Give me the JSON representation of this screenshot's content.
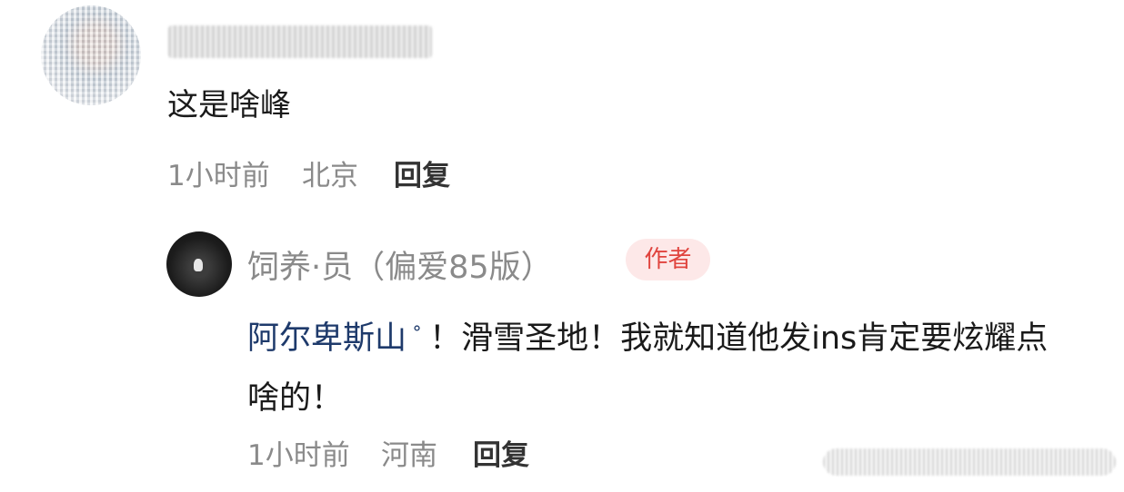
{
  "comment": {
    "text": "这是啥峰",
    "time": "1小时前",
    "location": "北京",
    "reply_label": "回复"
  },
  "reply": {
    "author_name": "饲养·员（偏爱85版）",
    "author_badge": "作者",
    "topic_link": "阿尔卑斯山",
    "topic_icon": "search-icon",
    "text_after_link": "！滑雪圣地！我就知道他发ins肯定要炫耀点啥的！",
    "time": "1小时前",
    "location": "河南",
    "reply_label": "回复"
  },
  "colors": {
    "meta_gray": "#8a8a8a",
    "badge_red": "#e0443e",
    "badge_bg": "#fde8e8",
    "link_blue": "#1e3a6b"
  }
}
